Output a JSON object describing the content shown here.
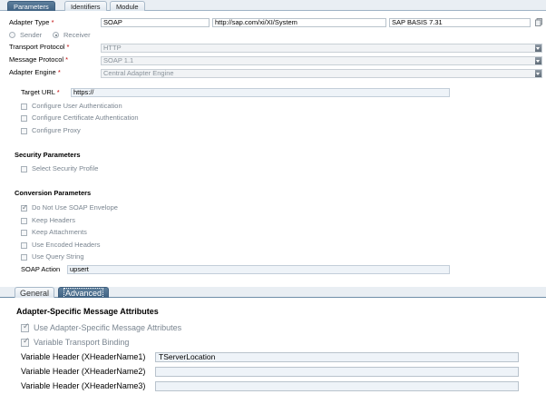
{
  "tabs": [
    {
      "label": "Parameters",
      "active": true
    },
    {
      "label": "Identifiers",
      "active": false
    },
    {
      "label": "Module",
      "active": false
    }
  ],
  "adapter": {
    "type_label": "Adapter Type",
    "type_value": "SOAP",
    "namespace_value": "http://sap.com/xi/XI/System",
    "software_component_value": "SAP BASIS 7.31",
    "sender_label": "Sender",
    "receiver_label": "Receiver",
    "direction_selected": "Receiver",
    "transport_protocol_label": "Transport Protocol",
    "transport_protocol_value": "HTTP",
    "message_protocol_label": "Message Protocol",
    "message_protocol_value": "SOAP 1.1",
    "adapter_engine_label": "Adapter Engine",
    "adapter_engine_value": "Central Adapter Engine",
    "required_mark": "*"
  },
  "connection": {
    "target_url_label": "Target URL",
    "target_url_value": "https://",
    "options": [
      {
        "label": "Configure User Authentication",
        "checked": false
      },
      {
        "label": "Configure Certificate Authentication",
        "checked": false
      },
      {
        "label": "Configure Proxy",
        "checked": false
      }
    ]
  },
  "security": {
    "title": "Security Parameters",
    "options": [
      {
        "label": "Select Security Profile",
        "checked": false
      }
    ]
  },
  "conversion": {
    "title": "Conversion Parameters",
    "options": [
      {
        "label": "Do Not Use SOAP Envelope",
        "checked": true
      },
      {
        "label": "Keep Headers",
        "checked": false
      },
      {
        "label": "Keep Attachments",
        "checked": false
      },
      {
        "label": "Use Encoded Headers",
        "checked": false
      },
      {
        "label": "Use Query String",
        "checked": false
      }
    ],
    "soap_action_label": "SOAP Action",
    "soap_action_value": "upsert"
  },
  "subtabs": [
    {
      "label": "General",
      "active": false
    },
    {
      "label": "Advanced",
      "active": true
    }
  ],
  "asma": {
    "title": "Adapter-Specific Message Attributes",
    "options": [
      {
        "label": "Use Adapter-Specific Message Attributes",
        "checked": true
      },
      {
        "label": "Variable Transport Binding",
        "checked": true
      }
    ],
    "variable_headers": [
      {
        "label": "Variable Header (XHeaderName1)",
        "value": "TServerLocation"
      },
      {
        "label": "Variable Header (XHeaderName2)",
        "value": ""
      },
      {
        "label": "Variable Header (XHeaderName3)",
        "value": ""
      }
    ]
  },
  "colors": {
    "active_tab": "#4a6c8c",
    "required": "#c00000",
    "field_border": "#b9c3cc"
  },
  "icons": {
    "copy": "copy-icon",
    "dropdown": "chevron-down-icon"
  }
}
